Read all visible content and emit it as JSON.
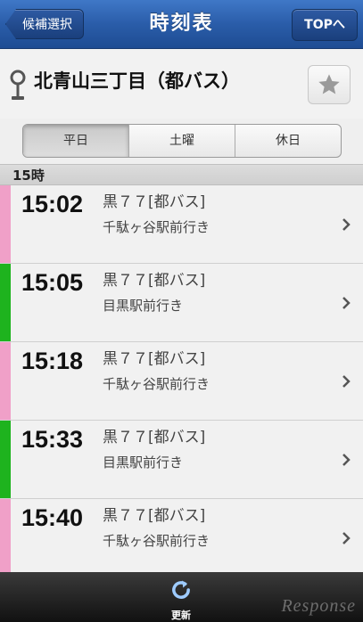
{
  "navbar": {
    "title": "時刻表",
    "back_label": "候補選択",
    "top_label": "TOPへ",
    "color": "#2a5da9"
  },
  "stop": {
    "name": "北青山三丁目（都バス）"
  },
  "segment": {
    "items": [
      {
        "label": "平日",
        "selected": true
      },
      {
        "label": "土曜",
        "selected": false
      },
      {
        "label": "休日",
        "selected": false
      }
    ]
  },
  "section": {
    "hour_label": "15時"
  },
  "departures": [
    {
      "time": "15:02",
      "route": "黒７７[都バス]",
      "destination": "千駄ヶ谷駅前行き",
      "color": "#f0a0c8"
    },
    {
      "time": "15:05",
      "route": "黒７７[都バス]",
      "destination": "目黒駅前行き",
      "color": "#1eb31e"
    },
    {
      "time": "15:18",
      "route": "黒７７[都バス]",
      "destination": "千駄ヶ谷駅前行き",
      "color": "#f0a0c8"
    },
    {
      "time": "15:33",
      "route": "黒７７[都バス]",
      "destination": "目黒駅前行き",
      "color": "#1eb31e"
    },
    {
      "time": "15:40",
      "route": "黒７７[都バス]",
      "destination": "千駄ヶ谷駅前行き",
      "color": "#f0a0c8"
    }
  ],
  "toolbar": {
    "refresh_label": "更新"
  },
  "watermark": "Response"
}
